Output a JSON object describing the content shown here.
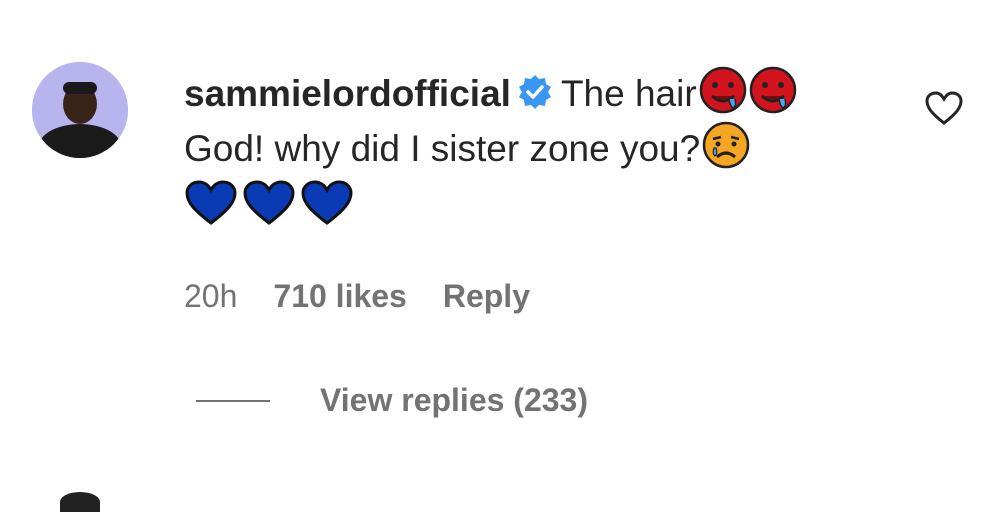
{
  "comment": {
    "username": "sammielordofficial",
    "text_line1": "The hair",
    "text_line2": "God! why did I sister zone you?",
    "emojis_line1": [
      "drooling-red-face-emoji",
      "drooling-red-face-emoji"
    ],
    "emoji_line2": "sad-crying-face-emoji",
    "hearts": [
      "blue-heart-icon",
      "blue-heart-icon",
      "blue-heart-icon"
    ]
  },
  "meta": {
    "time": "20h",
    "likes": "710 likes",
    "reply": "Reply"
  },
  "view_replies": "View replies (233)",
  "colors": {
    "verified_blue": "#3897f0",
    "heart_blue": "#0a3bb5",
    "emoji_red": "#d3141f",
    "muted_text": "#737373"
  }
}
